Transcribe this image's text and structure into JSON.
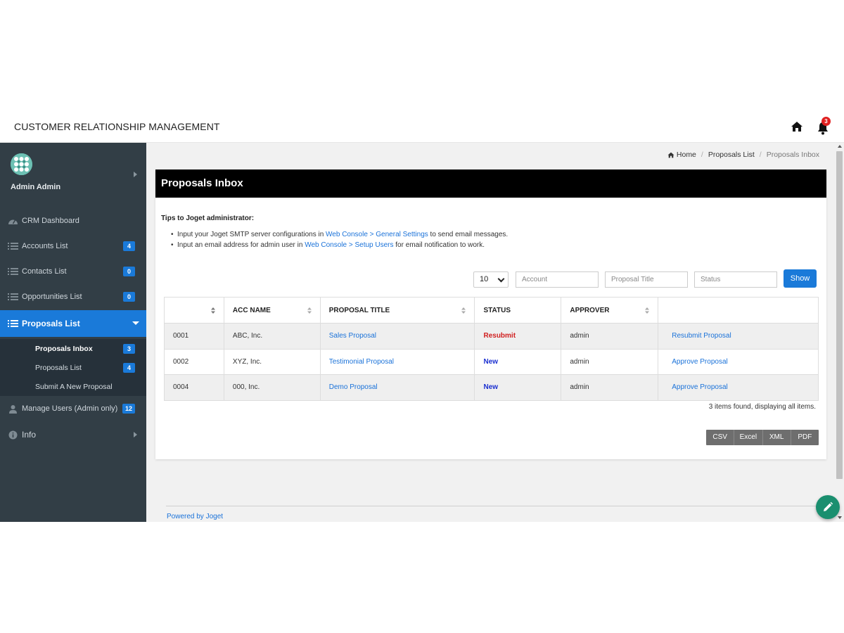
{
  "header": {
    "title": "CUSTOMER RELATIONSHIP MANAGEMENT",
    "notification_count": "3"
  },
  "sidebar": {
    "user_name": "Admin Admin",
    "items": [
      {
        "label": "CRM Dashboard",
        "icon": "dashboard-icon"
      },
      {
        "label": "Accounts List",
        "icon": "list-icon",
        "badge": "4"
      },
      {
        "label": "Contacts List",
        "icon": "list-icon",
        "badge": "0"
      },
      {
        "label": "Opportunities List",
        "icon": "list-icon",
        "badge": "0"
      },
      {
        "label": "Proposals List",
        "icon": "list-icon"
      },
      {
        "label": "Manage Users (Admin only)",
        "icon": "user-icon",
        "badge": "12"
      },
      {
        "label": "Info",
        "icon": "info-icon"
      }
    ],
    "submenu": [
      {
        "label": "Proposals Inbox",
        "badge": "3"
      },
      {
        "label": "Proposals List",
        "badge": "4"
      },
      {
        "label": "Submit A New Proposal"
      }
    ]
  },
  "breadcrumb": {
    "home": "Home",
    "parent": "Proposals List",
    "current": "Proposals Inbox"
  },
  "panel": {
    "title": "Proposals Inbox",
    "tips_title": "Tips to Joget administrator:",
    "tip1_pre": "Input your Joget SMTP server configurations in ",
    "tip1_link": "Web Console > General Settings",
    "tip1_post": " to send email messages.",
    "tip2_pre": "Input an email address for admin user in ",
    "tip2_link": "Web Console > Setup Users",
    "tip2_post": " for email notification to work."
  },
  "filters": {
    "page_size": "10",
    "account_placeholder": "Account",
    "title_placeholder": "Proposal Title",
    "status_placeholder": "Status",
    "show_label": "Show"
  },
  "table": {
    "columns": [
      "",
      "ACC NAME",
      "PROPOSAL TITLE",
      "STATUS",
      "APPROVER",
      ""
    ],
    "rows": [
      {
        "id": "0001",
        "acc": "ABC, Inc.",
        "title": "Sales Proposal",
        "status": "Resubmit",
        "approver": "admin",
        "action": "Resubmit Proposal"
      },
      {
        "id": "0002",
        "acc": "XYZ, Inc.",
        "title": "Testimonial Proposal",
        "status": "New",
        "approver": "admin",
        "action": "Approve Proposal"
      },
      {
        "id": "0004",
        "acc": "000, Inc.",
        "title": "Demo Proposal",
        "status": "New",
        "approver": "admin",
        "action": "Approve Proposal"
      }
    ],
    "summary": "3 items found, displaying all items."
  },
  "export": [
    "CSV",
    "Excel",
    "XML",
    "PDF"
  ],
  "footer": {
    "powered_by": "Powered by Joget"
  },
  "colors": {
    "accent": "#1a7ad9",
    "sidebar": "#323e46",
    "resubmit": "#d01f1f",
    "new": "#1a2fd0"
  }
}
